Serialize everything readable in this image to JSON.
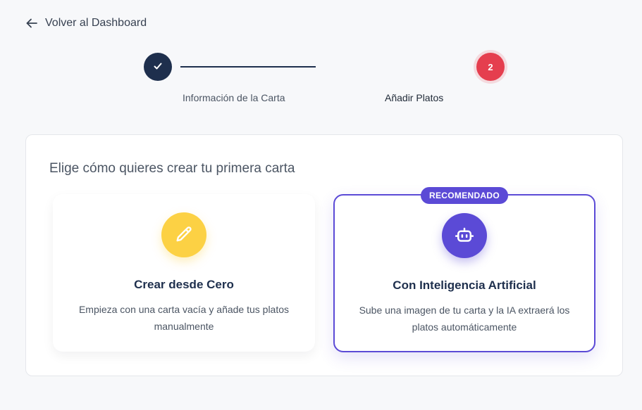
{
  "nav": {
    "back_label": "Volver al Dashboard",
    "back_icon": "arrow-left-icon"
  },
  "stepper": {
    "steps": [
      {
        "label": "Información de la Carta",
        "status": "completed",
        "icon": "check-icon"
      },
      {
        "label": "Añadir Platos",
        "status": "current",
        "number": "2"
      }
    ]
  },
  "main": {
    "title": "Elige cómo quieres crear tu primera carta",
    "options": [
      {
        "title": "Crear desde Cero",
        "description": "Empieza con una carta vacía y añade tus platos manualmente",
        "icon": "pencil-icon",
        "icon_color": "#fcd144"
      },
      {
        "title": "Con Inteligencia Artificial",
        "description": "Sube una imagen de tu carta y la IA extraerá los platos automáticamente",
        "icon": "robot-icon",
        "icon_color": "#5b4ad6",
        "badge": "RECOMENDADO"
      }
    ]
  },
  "colors": {
    "primary_dark": "#1e2f4d",
    "accent_red": "#e53e4e",
    "accent_purple": "#5b4ad6",
    "accent_yellow": "#fcd144"
  }
}
